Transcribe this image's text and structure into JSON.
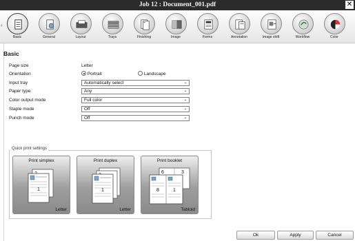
{
  "window": {
    "title": "Job 12 : Document_001.pdf",
    "close_glyph": "✕"
  },
  "toolbar": {
    "scroll_left_glyph": "‹",
    "items": [
      {
        "label": "Basic",
        "icon": "basic-document-icon",
        "active": true
      },
      {
        "label": "General",
        "icon": "general-settings-icon",
        "active": false
      },
      {
        "label": "Layout",
        "icon": "layout-icon",
        "active": false
      },
      {
        "label": "Trays",
        "icon": "trays-icon",
        "active": false
      },
      {
        "label": "Finishing",
        "icon": "finishing-icon",
        "active": false
      },
      {
        "label": "Image",
        "icon": "image-quality-icon",
        "active": false
      },
      {
        "label": "Forms",
        "icon": "forms-icon",
        "active": false
      },
      {
        "label": "Annotation",
        "icon": "annotation-icon",
        "active": false
      },
      {
        "label": "Image shift",
        "icon": "image-shift-icon",
        "active": false
      },
      {
        "label": "Workflow",
        "icon": "workflow-icon",
        "active": false
      },
      {
        "label": "Color",
        "icon": "color-icon",
        "active": false
      }
    ]
  },
  "basic": {
    "title": "Basic",
    "page_size": {
      "label": "Page size",
      "value": "Letter"
    },
    "orientation": {
      "label": "Orientation",
      "options": [
        "Portrait",
        "Landscape"
      ],
      "selected": "Portrait"
    },
    "input_tray": {
      "label": "Input tray",
      "value": "Automatically select"
    },
    "paper_type": {
      "label": "Paper type",
      "value": "Any"
    },
    "color_output_mode": {
      "label": "Color output mode",
      "value": "Full color"
    },
    "staple_mode": {
      "label": "Staple mode",
      "value": "Off"
    },
    "punch_mode": {
      "label": "Punch mode",
      "value": "Off"
    },
    "select_caret_glyph": "⌄"
  },
  "quick_print": {
    "legend": "Quick print settings",
    "presets": [
      {
        "title": "Print simplex",
        "size": "Letter",
        "page_numbers": [
          "2",
          "1"
        ]
      },
      {
        "title": "Print duplex",
        "size": "Letter",
        "page_numbers": [
          "3",
          "1"
        ]
      },
      {
        "title": "Print booklet",
        "size": "Tabloid",
        "page_numbers": [
          "6",
          "3",
          "8",
          "1"
        ]
      }
    ]
  },
  "footer": {
    "ok": "Ok",
    "apply": "Apply",
    "cancel": "Cancel"
  },
  "colors": {
    "titlebar": "#2b2b2b",
    "toolbar": "#eeeeee",
    "preset_bg": "#9e9e9e"
  }
}
